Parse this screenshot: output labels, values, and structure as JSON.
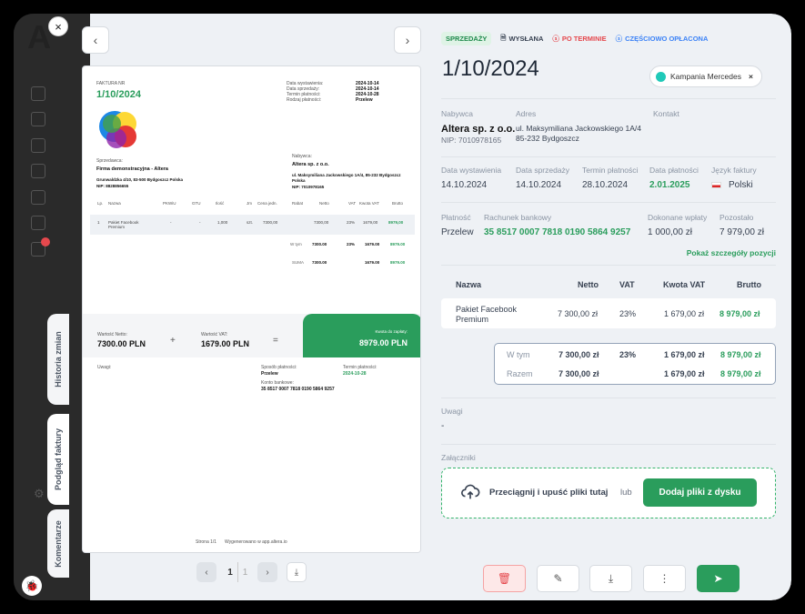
{
  "sidebar": {
    "logo": "A",
    "close": "×",
    "bug": "🐞",
    "gear": "⚙",
    "badge": "1"
  },
  "vtabs": {
    "history": "Historia zmian",
    "preview": "Podgląd faktury",
    "comments": "Komentarze"
  },
  "nav": {
    "prev": "‹",
    "next": "›"
  },
  "preview": {
    "title_small": "FAKTURA NR",
    "number": "1/10/2024",
    "dates_labels": [
      "Data wystawienia:",
      "Data sprzedaży:",
      "Termin płatności:",
      "Rodzaj płatności:"
    ],
    "dates_values": [
      "2024-10-14",
      "2024-10-14",
      "2024-10-28",
      "Przelew"
    ],
    "seller_label": "Sprzedawca:",
    "seller_name": "Firma demonstracyjna - Altera",
    "seller_addr": "Grunwaldzka 4/10, 83-500 Bydgoszcz Polska",
    "seller_nip": "NIP: 8828856655",
    "buyer_label": "Nabywca:",
    "buyer_name": "Altera sp. z o.o.",
    "buyer_addr": "ul. Maksymiliana Jackowskiego 1A/4, 85-232 Bydgoszcz Polska",
    "buyer_nip": "NIP: 7010978165",
    "headers": [
      "Lp.",
      "Nazwa",
      "PKWiU",
      "GTU",
      "Ilość",
      "Jm",
      "Cena jedn.",
      "Rabat",
      "Netto",
      "VAT",
      "Kwota VAT",
      "Brutto"
    ],
    "row": [
      "1",
      "Pakiet Facebook Premium",
      "-",
      "-",
      "1,000",
      "szt.",
      "7300,00",
      "",
      "7300,00",
      "23%",
      "1679,00",
      "8979,00"
    ],
    "wtym": [
      "W tym",
      "7300.00",
      "23%",
      "1679.00",
      "8979.00"
    ],
    "suma": [
      "SUMA",
      "7300.00",
      "",
      "1679.00",
      "8979.00"
    ],
    "netto_label": "Wartość Netto:",
    "netto_value": "7300.00 PLN",
    "plus": "+",
    "vat_label": "Wartość VAT:",
    "vat_value": "1679.00 PLN",
    "eq": "=",
    "due_label": "Kwota do zapłaty:",
    "due_value": "8979.00 PLN",
    "notes_label": "Uwagi:",
    "pay_method_label": "Sposób płatności:",
    "pay_method": "Przelew",
    "pay_due_label": "Termin płatności:",
    "pay_due": "2024-10-28",
    "bank_label": "Konto bankowe:",
    "bank": "35 8517 0007 7818 0190 5864 9257",
    "footer_page": "Strona 1/1",
    "footer_gen": "Wygenerowano w app.altera.io"
  },
  "pager": {
    "prev": "‹",
    "page": "1",
    "total": "1",
    "next": "›",
    "download": "⤓"
  },
  "tags": {
    "sales": "SPRZEDAŻY",
    "sent": "WYSŁANA",
    "overdue": "PO TERMINIE",
    "partial": "CZĘŚCIOWO OPŁACONA"
  },
  "invoice_number": "1/10/2024",
  "campaign": {
    "label": "Kampania Mercedes",
    "remove": "×"
  },
  "party": {
    "buyer_label": "Nabywca",
    "buyer_name": "Altera sp. z o.o.",
    "buyer_nip": "NIP: 7010978165",
    "address_label": "Adres",
    "address_1": "ul. Maksymiliana Jackowskiego 1A/4",
    "address_2": "85-232 Bydgoszcz",
    "contact_label": "Kontakt"
  },
  "dates": {
    "issue_label": "Data wystawienia",
    "issue": "14.10.2024",
    "sale_label": "Data sprzedaży",
    "sale": "14.10.2024",
    "due_label": "Termin płatności",
    "due": "28.10.2024",
    "paid_label": "Data płatności",
    "paid": "2.01.2025",
    "lang_label": "Język faktury",
    "lang": "Polski"
  },
  "payment": {
    "method_label": "Płatność",
    "method": "Przelew",
    "bank_label": "Rachunek bankowy",
    "bank": "35 8517 0007 7818 0190 5864 9257",
    "paid_label": "Dokonane wpłaty",
    "paid": "1 000,00 zł",
    "rest_label": "Pozostało",
    "rest": "7 979,00 zł",
    "details_link": "Pokaż szczegóły pozycji"
  },
  "items": {
    "headers": {
      "name": "Nazwa",
      "net": "Netto",
      "vat": "VAT",
      "vat_amount": "Kwota VAT",
      "gross": "Brutto"
    },
    "row": {
      "name1": "Pakiet Facebook",
      "name2": "Premium",
      "net": "7 300,00 zł",
      "vat": "23%",
      "vat_amount": "1 679,00 zł",
      "gross": "8 979,00 zł"
    },
    "wtym": {
      "label": "W tym",
      "net": "7 300,00 zł",
      "vat": "23%",
      "vat_amount": "1 679,00 zł",
      "gross": "8 979,00 zł"
    },
    "razem": {
      "label": "Razem",
      "net": "7 300,00 zł",
      "vat_amount": "1 679,00 zł",
      "gross": "8 979,00 zł"
    }
  },
  "notes": {
    "label": "Uwagi",
    "value": "-"
  },
  "attachments": {
    "label": "Załączniki",
    "drop_text": "Przeciągnij i upuść pliki tutaj",
    "or": "lub",
    "button": "Dodaj pliki z dysku"
  },
  "actions": {
    "delete": "🗑",
    "edit": "✎",
    "download": "⤓",
    "more": "⋮",
    "send": "➤"
  },
  "colors": {
    "accent": "#2a9d5c",
    "danger": "#e5484d",
    "info": "#3b82f6"
  }
}
